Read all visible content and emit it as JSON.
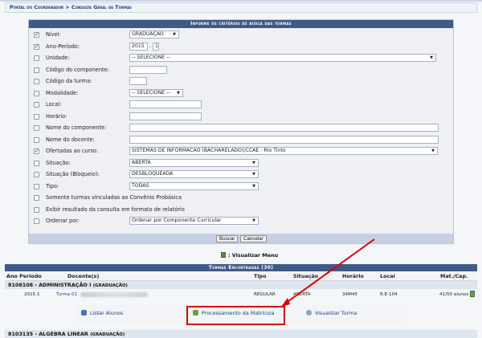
{
  "breadcrumb": "Portal do Coordenador > Consulta Geral de Turmas",
  "form": {
    "header": "Informe os critérios de busca das turmas",
    "rows": [
      {
        "label": "Nível:",
        "checked": true
      },
      {
        "label": "Ano-Período:",
        "checked": true
      },
      {
        "label": "Unidade:",
        "checked": false
      },
      {
        "label": "Código do componente:",
        "checked": false
      },
      {
        "label": "Código da turma:",
        "checked": false
      },
      {
        "label": "Modalidade:",
        "checked": false
      },
      {
        "label": "Local:",
        "checked": false
      },
      {
        "label": "Horário:",
        "checked": false
      },
      {
        "label": "Nome do componente:",
        "checked": false
      },
      {
        "label": "Nome do docente:",
        "checked": false
      },
      {
        "label": "Ofertadas ao curso:",
        "checked": true
      },
      {
        "label": "Situação:",
        "checked": false
      },
      {
        "label": "Situação (Bloqueio):",
        "checked": false
      },
      {
        "label": "Tipo:",
        "checked": false
      },
      {
        "label": "Somente turmas vinculadas ao Convênio Probásica",
        "checked": false
      },
      {
        "label": "Exibir resultado da consulta em formato de relatório",
        "checked": false
      },
      {
        "label": "Ordenar por:",
        "checked": false
      }
    ],
    "nivel_value": "GRADUAÇÃO",
    "ano_value": "2015",
    "periodo_value": "1",
    "unidade_value": "-- SELECIONE --",
    "codigo_componente_value": "",
    "codigo_turma_value": "",
    "modalidade_value": "-- SELECIONE --",
    "local_value": "",
    "horario_value": "",
    "nome_componente_value": "",
    "nome_docente_value": "",
    "curso_value": "SISTEMAS DE INFORMACAO (BACHARELADO)/CCAE - Rio Tinto",
    "situacao_value": "ABERTA",
    "bloqueio_value": "DESBLOQUEADA",
    "tipo_value": "TODAS",
    "ordenar_value": "Ordenar por Componente Curricular",
    "buscar_label": "Buscar",
    "cancelar_label": "Cancelar"
  },
  "visualizar_menu": ": Visualizar Menu",
  "results": {
    "header": "Turmas Encontradas (30)",
    "columns": {
      "ano": "Ano Período",
      "docentes": "Docente(s)",
      "tipo": "Tipo",
      "situacao": "Situação",
      "horario": "Horário",
      "local": "Local",
      "cap": "Mat./Cap."
    },
    "group1": {
      "title": "8108108 - ADMINISTRAÇÃO I",
      "level": "(GRADUAÇÃO)"
    },
    "row1": {
      "ano": "2015.1",
      "turma": "Turma 01",
      "tipo": "REGULAR",
      "situacao": "ABERTA",
      "horario": "34M45",
      "local": "R.E-104",
      "cap": "41/50 alunos"
    },
    "actions": {
      "listar": "Listar Alunos",
      "processamento": "Processamento da Matrícula",
      "visualizar": "Visualizar Turma"
    },
    "group2": {
      "title": "8103135 - ALGEBRA LINEAR",
      "level": "(GRADUAÇÃO)"
    }
  },
  "colors": {
    "header_blue": "#3e5a86",
    "highlight_red": "#e00000",
    "link_blue": "#1f3d9a"
  }
}
